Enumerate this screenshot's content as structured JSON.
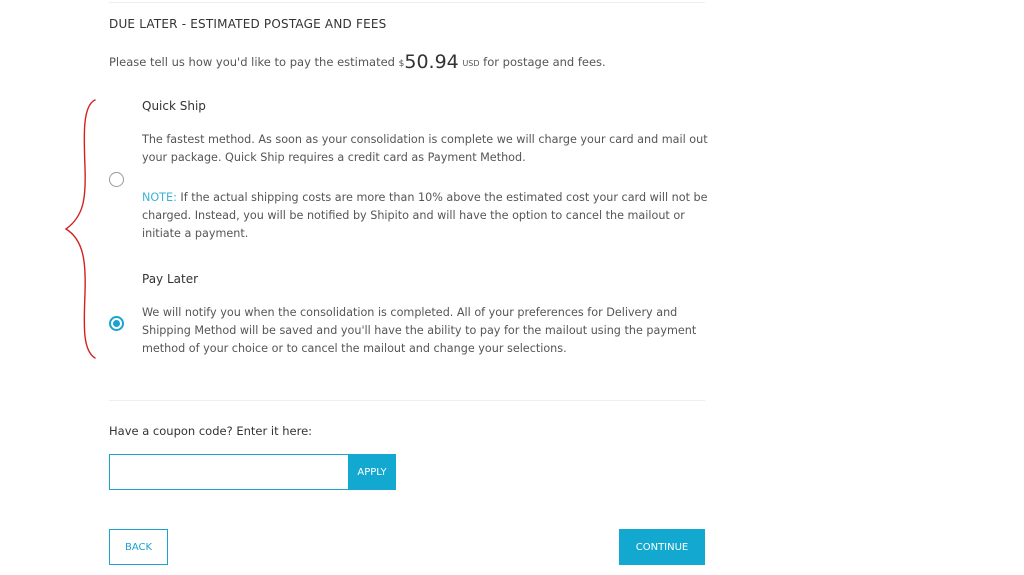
{
  "section": {
    "title": "DUE LATER - ESTIMATED POSTAGE AND FEES",
    "intro_before": "Please tell us how you'd like to pay the estimated ",
    "currency_symbol": "$",
    "amount": "50.94",
    "currency_code": "USD",
    "intro_after": " for postage and fees."
  },
  "options": [
    {
      "title": "Quick Ship",
      "description": "The fastest method. As soon as your consolidation is complete we will charge your card and mail out your package. Quick Ship requires a credit card as Payment Method.",
      "note_label": "NOTE:",
      "note_text": " If the actual shipping costs are more than 10% above the estimated cost your card will not be charged. Instead, you will be notified by Shipito and will have the option to cancel the mailout or initiate a payment.",
      "selected": false
    },
    {
      "title": "Pay Later",
      "description": "We will notify you when the consolidation is completed. All of your preferences for Delivery and Shipping Method will be saved and you'll have the ability to pay for the mailout using the payment method of your choice or to cancel the mailout and change your selections.",
      "selected": true
    }
  ],
  "coupon": {
    "label": "Have a coupon code? Enter it here:",
    "value": "",
    "apply_label": "APPLY"
  },
  "buttons": {
    "back_label": "BACK",
    "continue_label": "CONTINUE"
  },
  "colors": {
    "accent": "#12a8d0",
    "annotation": "#d42020"
  }
}
